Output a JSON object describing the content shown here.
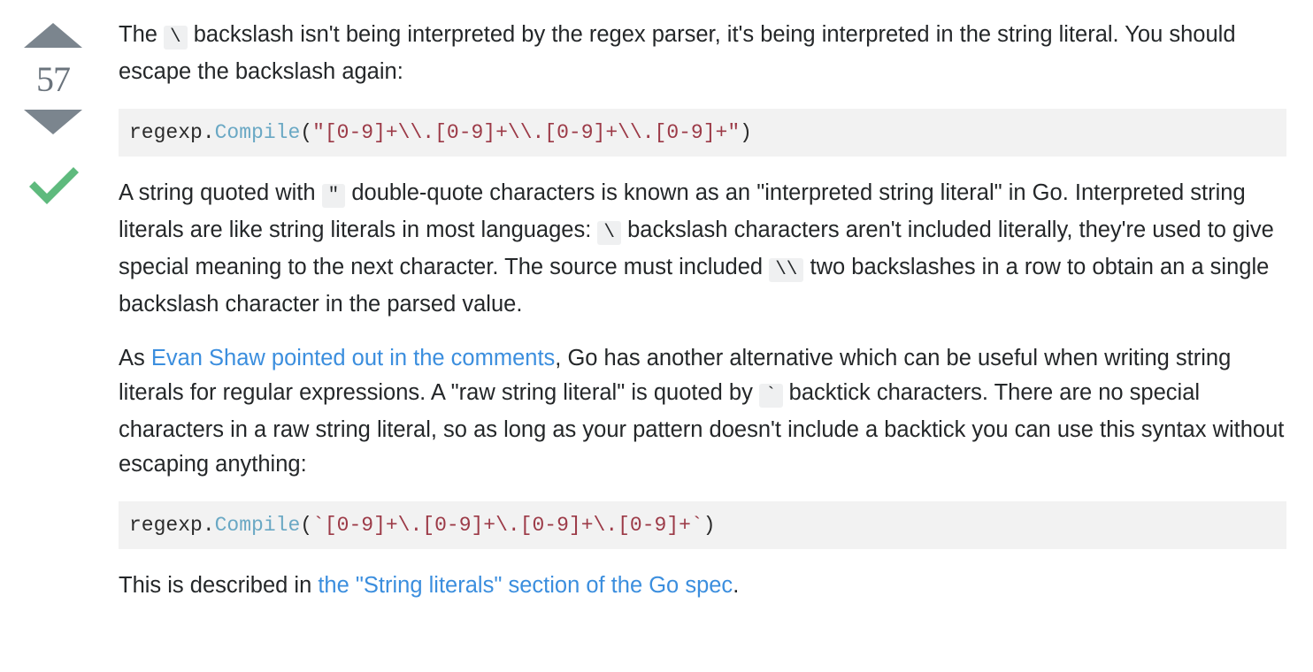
{
  "vote": {
    "upvote_icon": "triangle-up-icon",
    "downvote_icon": "triangle-down-icon",
    "count": "57",
    "accepted_icon": "check-mark-icon",
    "arrow_color": "#7b858e",
    "count_color": "#6a737c",
    "accepted_color": "#5eba7d"
  },
  "colors": {
    "link": "#3b8ede",
    "inline_code_bg": "#eff0f1",
    "code_block_bg": "#f2f2f2",
    "code_function": "#6aa8c4",
    "code_string": "#9c3a47",
    "text": "#242729"
  },
  "paragraphs": {
    "p1": {
      "part1": "The ",
      "code1": "\\",
      "part2": " backslash isn't being interpreted by the regex parser, it's being interpreted in the string literal. You should escape the backslash again:"
    },
    "p2": {
      "part1": "A string quoted with ",
      "code1": "\"",
      "part2": " double-quote characters is known as an \"interpreted string literal\" in Go. Interpreted string literals are like string literals in most languages: ",
      "code2": "\\",
      "part3": " backslash characters aren't included literally, they're used to give special meaning to the next character. The source must included ",
      "code3": "\\\\",
      "part4": " two backslashes in a row to obtain an a single backslash character in the parsed value."
    },
    "p3": {
      "part1": "As ",
      "link1": "Evan Shaw pointed out in the comments",
      "part2": ", Go has another alternative which can be useful when writing string literals for regular expressions. A \"raw string literal\" is quoted by ",
      "code1": "`",
      "part3": " backtick characters. There are no special characters in a raw string literal, so as long as your pattern doesn't include a backtick you can use this syntax without escaping anything:"
    },
    "p4": {
      "part1": "This is described in ",
      "link1": "the \"String literals\" section of the Go spec",
      "part2": "."
    }
  },
  "code_blocks": {
    "block1": {
      "pkg": "regexp.",
      "fn": "Compile",
      "open_paren": "(",
      "string": "\"[0-9]+\\\\.[0-9]+\\\\.[0-9]+\\\\.[0-9]+\"",
      "close_paren": ")"
    },
    "block2": {
      "pkg": "regexp.",
      "fn": "Compile",
      "open_paren": "(",
      "string": "`[0-9]+\\.[0-9]+\\.[0-9]+\\.[0-9]+`",
      "close_paren": ")"
    }
  }
}
